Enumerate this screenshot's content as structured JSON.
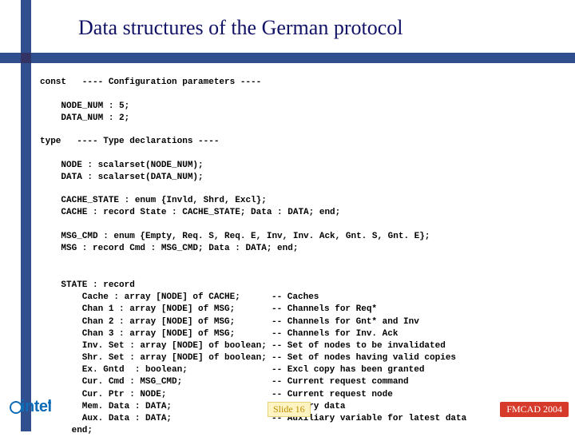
{
  "title": "Data structures of the German protocol",
  "code": {
    "const_header": "const   ---- Configuration parameters ----",
    "node_num": "    NODE_NUM : 5;",
    "data_num": "    DATA_NUM : 2;",
    "type_header": "type   ---- Type declarations ----",
    "node_decl": "    NODE : scalarset(NODE_NUM);",
    "data_decl": "    DATA : scalarset(DATA_NUM);",
    "cache_state_decl": "    CACHE_STATE : enum {Invld, Shrd, Excl};",
    "cache_decl": "    CACHE : record State : CACHE_STATE; Data : DATA; end;",
    "msg_cmd_decl": "    MSG_CMD : enum {Empty, Req. S, Req. E, Inv, Inv. Ack, Gnt. S, Gnt. E};",
    "msg_decl": "    MSG : record Cmd : MSG_CMD; Data : DATA; end;",
    "state_header": "    STATE : record",
    "state_end": "      end;"
  },
  "state_rows": [
    {
      "left": "        Cache : array [NODE] of CACHE;",
      "right": "-- Caches"
    },
    {
      "left": "        Chan 1 : array [NODE] of MSG;",
      "right": "-- Channels for Req*"
    },
    {
      "left": "        Chan 2 : array [NODE] of MSG;",
      "right": "-- Channels for Gnt* and Inv"
    },
    {
      "left": "        Chan 3 : array [NODE] of MSG;",
      "right": "-- Channels for Inv. Ack"
    },
    {
      "left": "        Inv. Set : array [NODE] of boolean;",
      "right": "-- Set of nodes to be invalidated"
    },
    {
      "left": "        Shr. Set : array [NODE] of boolean;",
      "right": "-- Set of nodes having valid copies"
    },
    {
      "left": "        Ex. Gntd  : boolean;",
      "right": "-- Excl copy has been granted"
    },
    {
      "left": "        Cur. Cmd : MSG_CMD;",
      "right": "-- Current request command"
    },
    {
      "left": "        Cur. Ptr : NODE;",
      "right": "-- Current request node"
    },
    {
      "left": "        Mem. Data : DATA;",
      "right": "-- Memory data"
    },
    {
      "left": "        Aux. Data : DATA;",
      "right": "-- Auxiliary variable for latest data"
    }
  ],
  "logo_text": "intel",
  "slide_label": "Slide 16",
  "conference": "FMCAD 2004"
}
